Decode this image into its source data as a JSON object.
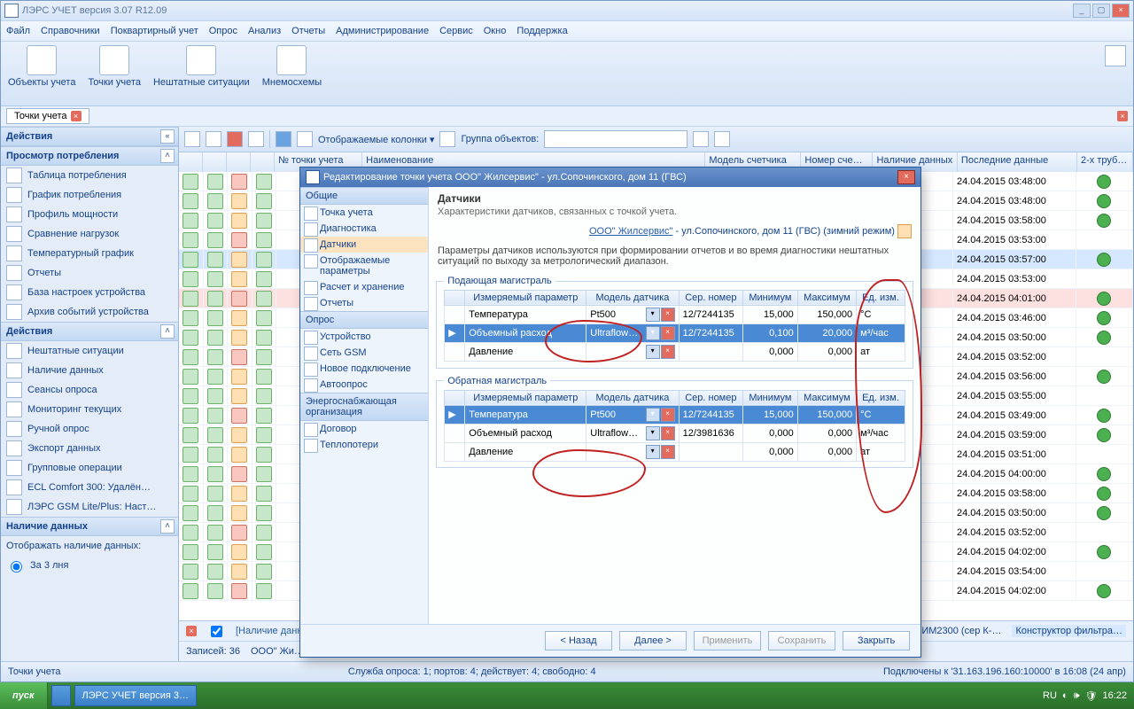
{
  "app": {
    "title": "ЛЭРС УЧЕТ версия 3.07 R12.09"
  },
  "menu": [
    "Файл",
    "Справочники",
    "Поквартирный учет",
    "Опрос",
    "Анализ",
    "Отчеты",
    "Администрирование",
    "Сервис",
    "Окно",
    "Поддержка"
  ],
  "maintb": [
    {
      "label": "Объекты учета"
    },
    {
      "label": "Точки учета"
    },
    {
      "label": "Нештатные ситуации"
    },
    {
      "label": "Мнемосхемы"
    }
  ],
  "doctab": "Точки учета",
  "left": {
    "actions": "Действия",
    "grp1": {
      "title": "Просмотр потребления",
      "items": [
        "Таблица потребления",
        "График потребления",
        "Профиль мощности",
        "Сравнение нагрузок",
        "Температурный график",
        "Отчеты",
        "База настроек устройства",
        "Архив событий устройства"
      ]
    },
    "grp2": {
      "title": "Действия",
      "items": [
        "Нештатные ситуации",
        "Наличие данных",
        "Сеансы опроса",
        "Мониторинг текущих",
        "Ручной опрос",
        "Экспорт данных",
        "Групповые операции",
        "ECL Comfort 300: Удалён…",
        "ЛЭРС GSM Lite/Plus: Наст…"
      ]
    },
    "grp3": {
      "title": "Наличие данных",
      "label": "Отображать наличие данных:",
      "opt": "За 3 лня"
    }
  },
  "gridtb": {
    "cols": "Отображаемые колонки ▾",
    "grplabel": "Группа объектов:"
  },
  "gridcols": [
    "",
    "",
    "",
    "",
    "№ точки учета",
    "Наименование",
    "Модель счетчика",
    "Номер сче…",
    "Наличие данных",
    "Последние данные",
    "2-х труб…"
  ],
  "rows": [
    {
      "dt": "24.04.2015 03:48:00",
      "ok": true
    },
    {
      "dt": "24.04.2015 03:48:00",
      "ok": true
    },
    {
      "dt": "24.04.2015 03:58:00",
      "ok": true
    },
    {
      "dt": "24.04.2015 03:53:00"
    },
    {
      "dt": "24.04.2015 03:57:00",
      "ok": true,
      "sel2": true
    },
    {
      "dt": "24.04.2015 03:53:00"
    },
    {
      "dt": "24.04.2015 04:01:00",
      "ok": true,
      "sel": true
    },
    {
      "dt": "24.04.2015 03:46:00",
      "ok": true
    },
    {
      "dt": "24.04.2015 03:50:00",
      "ok": true
    },
    {
      "dt": "24.04.2015 03:52:00"
    },
    {
      "dt": "24.04.2015 03:56:00",
      "ok": true
    },
    {
      "dt": "24.04.2015 03:55:00"
    },
    {
      "dt": "24.04.2015 03:49:00",
      "ok": true
    },
    {
      "dt": "24.04.2015 03:59:00",
      "ok": true
    },
    {
      "dt": "24.04.2015 03:51:00"
    },
    {
      "dt": "24.04.2015 04:00:00",
      "ok": true
    },
    {
      "dt": "24.04.2015 03:58:00",
      "ok": true
    },
    {
      "dt": "24.04.2015 03:50:00",
      "ok": true
    },
    {
      "dt": "24.04.2015 03:52:00"
    },
    {
      "dt": "24.04.2015 04:02:00",
      "ok": true
    },
    {
      "dt": "24.04.2015 03:54:00"
    },
    {
      "dt": "24.04.2015 04:02:00",
      "ok": true
    }
  ],
  "gridfoot": {
    "records": "Записей: 36",
    "obj": "ООО\" Жи…",
    "link": "[Наличие данных",
    "tail1": "'ИМ2300 (сер К-…",
    "tail2": "Конструктор фильтра…"
  },
  "status": {
    "left": "Точки учета",
    "mid": "Служба опроса: 1; портов: 4; действует: 4; свободно: 4",
    "right": "Подключены к '31.163.196.160:10000' в 16:08 (24 апр)"
  },
  "dlg": {
    "title": "Редактирование точки учета ООО\" Жилсервис\" - ул.Сопочинского, дом 11 (ГВС)",
    "h": "Датчики",
    "sub": "Характеристики датчиков, связанных с точкой учета.",
    "crumbLink": "ООО\" Жилсервис\"",
    "crumbRest": " - ул.Сопочинского, дом 11 (ГВС) (зимний режим)",
    "note": "Параметры датчиков используются при формировании отчетов и во время диагностики нештатных ситуаций по выходу за метрологический диапазон.",
    "nav": {
      "g1": "Общие",
      "g1items": [
        "Точка учета",
        "Диагностика",
        "Датчики",
        "Отображаемые параметры",
        "Расчет и хранение",
        "Отчеты"
      ],
      "g2": "Опрос",
      "g2items": [
        "Устройство",
        "Сеть GSM",
        "Новое подключение",
        "Автоопрос"
      ],
      "g3": "Энергоснабжающая организация",
      "g3items": [
        "Договор",
        "Теплопотери"
      ]
    },
    "tcols": [
      "Измеряемый параметр",
      "Модель датчика",
      "Сер. номер",
      "Минимум",
      "Максимум",
      "Ед. изм."
    ],
    "supply": {
      "legend": "Подающая магистраль",
      "rows": [
        {
          "p": "Температура",
          "m": "Pt500",
          "s": "12/7244135",
          "min": "15,000",
          "max": "150,000",
          "u": "°C"
        },
        {
          "p": "Объемный расход",
          "m": "Ultraflow…",
          "s": "12/7244135",
          "min": "0,100",
          "max": "20,000",
          "u": "м³/час",
          "sel": true
        },
        {
          "p": "Давление",
          "m": "",
          "s": "",
          "min": "0,000",
          "max": "0,000",
          "u": "ат"
        }
      ]
    },
    "return": {
      "legend": "Обратная магистраль",
      "rows": [
        {
          "p": "Температура",
          "m": "Pt500",
          "s": "12/7244135",
          "min": "15,000",
          "max": "150,000",
          "u": "°C",
          "sel": true
        },
        {
          "p": "Объемный расход",
          "m": "Ultraflow…",
          "s": "12/3981636",
          "min": "0,000",
          "max": "0,000",
          "u": "м³/час"
        },
        {
          "p": "Давление",
          "m": "",
          "s": "",
          "min": "0,000",
          "max": "0,000",
          "u": "ат"
        }
      ]
    },
    "btns": {
      "back": "< Назад",
      "next": "Далее >",
      "apply": "Применить",
      "save": "Сохранить",
      "close": "Закрыть"
    }
  },
  "taskbar": {
    "start": "пуск",
    "task": "ЛЭРС УЧЕТ версия 3…",
    "lang": "RU",
    "time": "16:22"
  }
}
